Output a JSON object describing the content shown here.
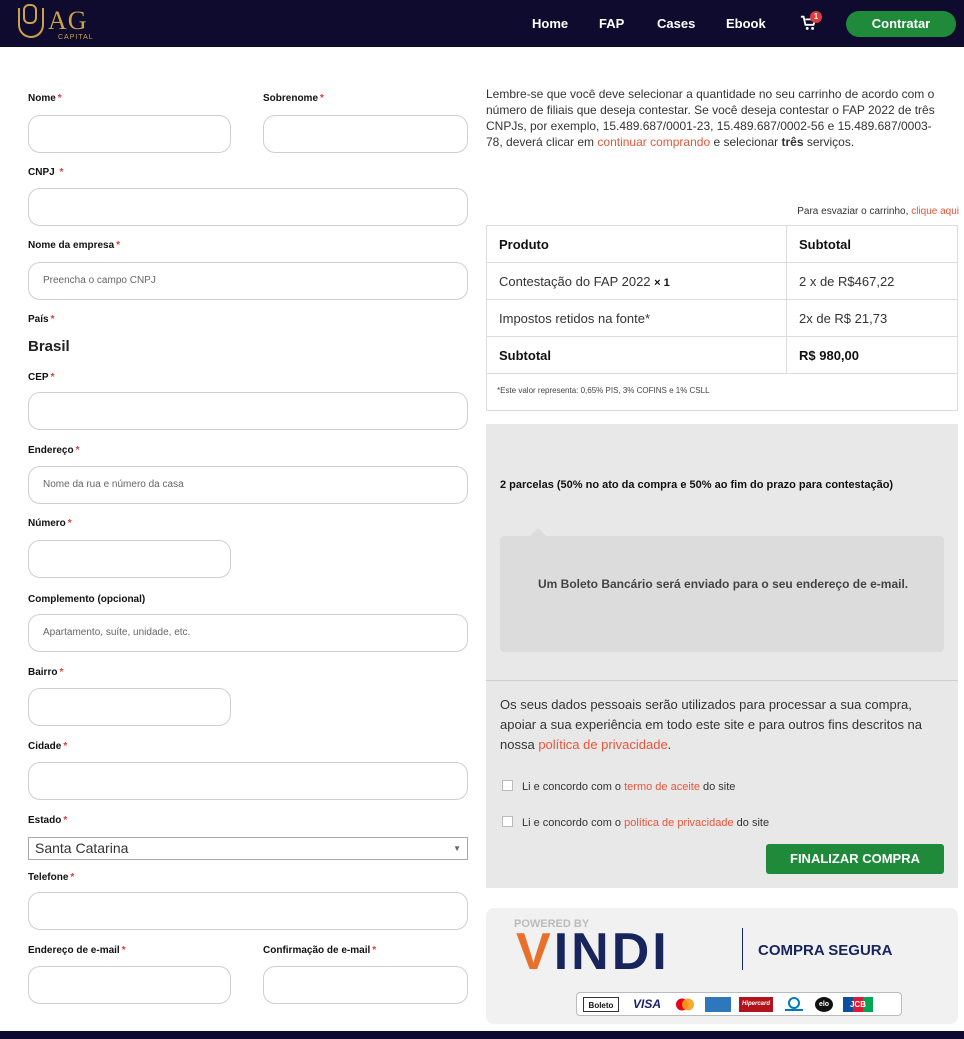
{
  "header": {
    "logo_text": "AG",
    "logo_sub": "CAPITAL",
    "nav": [
      "Home",
      "FAP",
      "Cases",
      "Ebook"
    ],
    "cart_count": "1",
    "cta_label": "Contratar",
    "brand_color": "#0f0b2e",
    "accent_color": "#1f8a3a"
  },
  "form": {
    "nome_label": "Nome",
    "sobrenome_label": "Sobrenome",
    "cnpj_label": "CNPJ",
    "empresa_label": "Nome da empresa",
    "empresa_placeholder": "Preencha o campo CNPJ",
    "pais_label": "País",
    "pais_value": "Brasil",
    "cep_label": "CEP",
    "endereco_label": "Endereço",
    "endereco_placeholder": "Nome da rua e número da casa",
    "numero_label": "Número",
    "complemento_label": "Complemento (opcional)",
    "complemento_placeholder": "Apartamento, suíte, unidade, etc.",
    "bairro_label": "Bairro",
    "cidade_label": "Cidade",
    "estado_label": "Estado",
    "estado_value": "Santa Catarina",
    "telefone_label": "Telefone",
    "email_label": "Endereço de e-mail",
    "email_confirm_label": "Confirmação de e-mail",
    "required_mark": "*"
  },
  "notice": {
    "text_before": "Lembre-se que você deve selecionar a quantidade no seu carrinho de acordo com o número de filiais que deseja contestar. Se você deseja contestar o FAP 2022 de três CNPJs, por exemplo,  15.489.687/0001-23, 15.489.687/0002-56 e 15.489.687/0003-78, deverá clicar em ",
    "link": "continuar comprando",
    "text_mid": " e selecionar ",
    "bold": "três",
    "text_after": " serviços."
  },
  "empty_cart": {
    "text": "Para esvaziar o carrinho, ",
    "link": "clique aqui"
  },
  "cart_table": {
    "col_product": "Produto",
    "col_subtotal": "Subtotal",
    "rows": [
      {
        "product": "Contestação do FAP 2022",
        "qty": "× 1",
        "subtotal": "2 x de R$467,22"
      },
      {
        "product": "Impostos retidos na fonte*",
        "qty": "",
        "subtotal": "2x de R$ 21,73"
      }
    ],
    "total_label": "Subtotal",
    "total_value": "R$ 980,00",
    "note": "*Este valor representa: 0,65% PIS, 3% COFINS e 1% CSLL"
  },
  "payment": {
    "title": "2 parcelas (50% no ato da compra e 50% ao fim do prazo para contestação)",
    "box_text": "Um Boleto Bancário será enviado para o seu endereço de e-mail.",
    "privacy_text": "Os seus dados pessoais serão utilizados para processar a sua compra, apoiar a sua experiência em todo este site e para outros fins descritos na nossa ",
    "privacy_link": "política de privacidade",
    "privacy_end": ".",
    "check1_before": "Li e concordo com o ",
    "check1_link": "termo de aceite",
    "check1_after": " do site",
    "check2_before": "Li e concordo com o ",
    "check2_link": "política de privacidade",
    "check2_after": " do site",
    "finalize_label": "FINALIZAR COMPRA"
  },
  "secure": {
    "powered": "POWERED BY",
    "brand": "VINDI",
    "brand_first": "V",
    "brand_rest": "INDI",
    "tagline": "COMPRA SEGURA",
    "cards": [
      "Boleto",
      "VISA",
      "Mastercard",
      "Amex",
      "Hipercard",
      "Diners",
      "elo",
      "JCB"
    ],
    "cards_shown": [
      "Boleto",
      "VISA",
      "Hipercard",
      "elo",
      "JCB"
    ]
  }
}
